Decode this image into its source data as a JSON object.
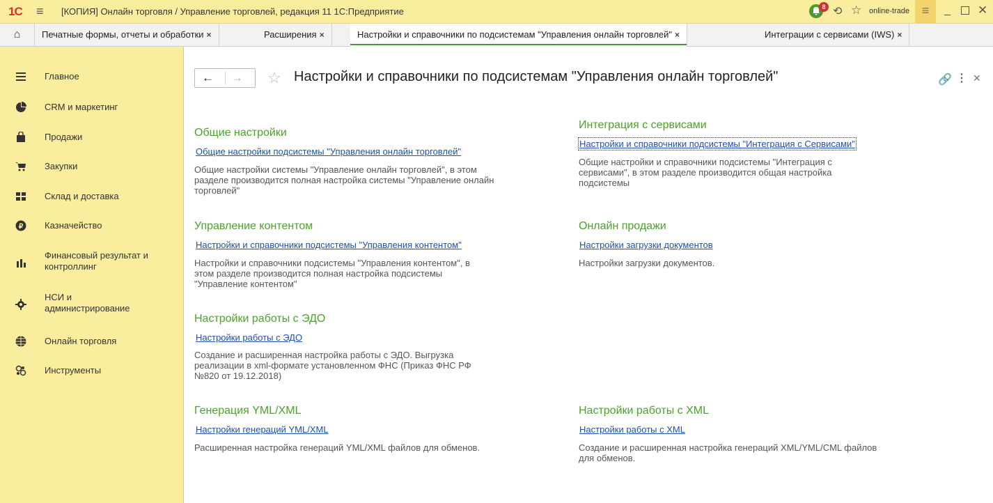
{
  "titlebar": {
    "logo": "1С",
    "title": "[КОПИЯ] Онлайн торговля / Управление торговлей, редакция 11 1С:Предприятие",
    "notification_count": "8",
    "user": "online-trade"
  },
  "tabs": [
    {
      "label": "Печатные формы, отчеты и обработки"
    },
    {
      "label": "Расширения"
    },
    {
      "label": "Настройки и справочники по подсистемам \"Управления онлайн торговлей\""
    },
    {
      "label": "Интеграции с сервисами (IWS)"
    }
  ],
  "sidebar": {
    "items": [
      {
        "label": "Главное",
        "icon": "menu-icon"
      },
      {
        "label": "CRM и маркетинг",
        "icon": "pie-icon"
      },
      {
        "label": "Продажи",
        "icon": "bag-icon"
      },
      {
        "label": "Закупки",
        "icon": "cart-icon"
      },
      {
        "label": "Склад и доставка",
        "icon": "warehouse-icon"
      },
      {
        "label": "Казначейство",
        "icon": "ruble-icon"
      },
      {
        "label": "Финансовый результат и",
        "label2": "контроллинг",
        "icon": "bar-chart-icon"
      },
      {
        "label": "НСИ и",
        "label2": "администрирование",
        "icon": "gear-icon"
      },
      {
        "label": "Онлайн торговля",
        "icon": "globe-icon"
      },
      {
        "label": "Инструменты",
        "icon": "tools-icon"
      }
    ]
  },
  "page": {
    "title": "Настройки и справочники по подсистемам \"Управления онлайн торговлей\""
  },
  "sections": {
    "general": {
      "title": "Общие настройки",
      "link": "Общие настройки подсистемы \"Управления онлайн торговлей\"",
      "desc1": "Общие настройки системы \"Управление онлайн торговлей\", в этом",
      "desc2": "разделе производится полная настройка системы \"Управление онлайн",
      "desc3": "торговлей\""
    },
    "integration": {
      "title": "Интеграция с сервисами",
      "link": "Настройки и справочники подсистемы \"Интеграция с Сервисами\"",
      "desc1": "Общие настройки и справочники подсистемы \"Интеграция с",
      "desc2": "сервисами\", в этом разделе производится общая настройка",
      "desc3": "подсистемы"
    },
    "content": {
      "title": "Управление контентом",
      "link": "Настройки и справочники подсистемы \"Управления контентом\"",
      "desc1": "Настройки и справочники подсистемы \"Управления контентом\", в",
      "desc2": "этом разделе производится полная настройка подсистемы",
      "desc3": "\"Управление контентом\""
    },
    "online_sales": {
      "title": "Онлайн продажи",
      "link": "Настройки загрузки документов",
      "desc1": "Настройки загрузки документов."
    },
    "edo": {
      "title": "Настройки работы с ЭДО",
      "link": "Настройки работы с ЭДО",
      "desc1": "Создание и расширенная настройка работы с ЭДО. Выгрузка",
      "desc2": "реализации в xml-формате установленном ФНС (Приказ ФНС РФ",
      "desc3": "№820 от 19.12.2018)"
    },
    "yml": {
      "title": "Генерация YML/XML",
      "link": "Настройки генераций YML/XML",
      "desc1": "Расширенная настройка генераций YML/XML файлов для обменов."
    },
    "xml": {
      "title": "Настройки работы с XML",
      "link": "Настройки работы с XML",
      "desc1": "Создание и расширенная настройка генераций XML/YML/CML файлов",
      "desc2": "для обменов."
    }
  },
  "colors": {
    "accent_yellow": "#fbed9e",
    "section_green": "#4aa329",
    "link_blue": "#1f4fb3"
  }
}
